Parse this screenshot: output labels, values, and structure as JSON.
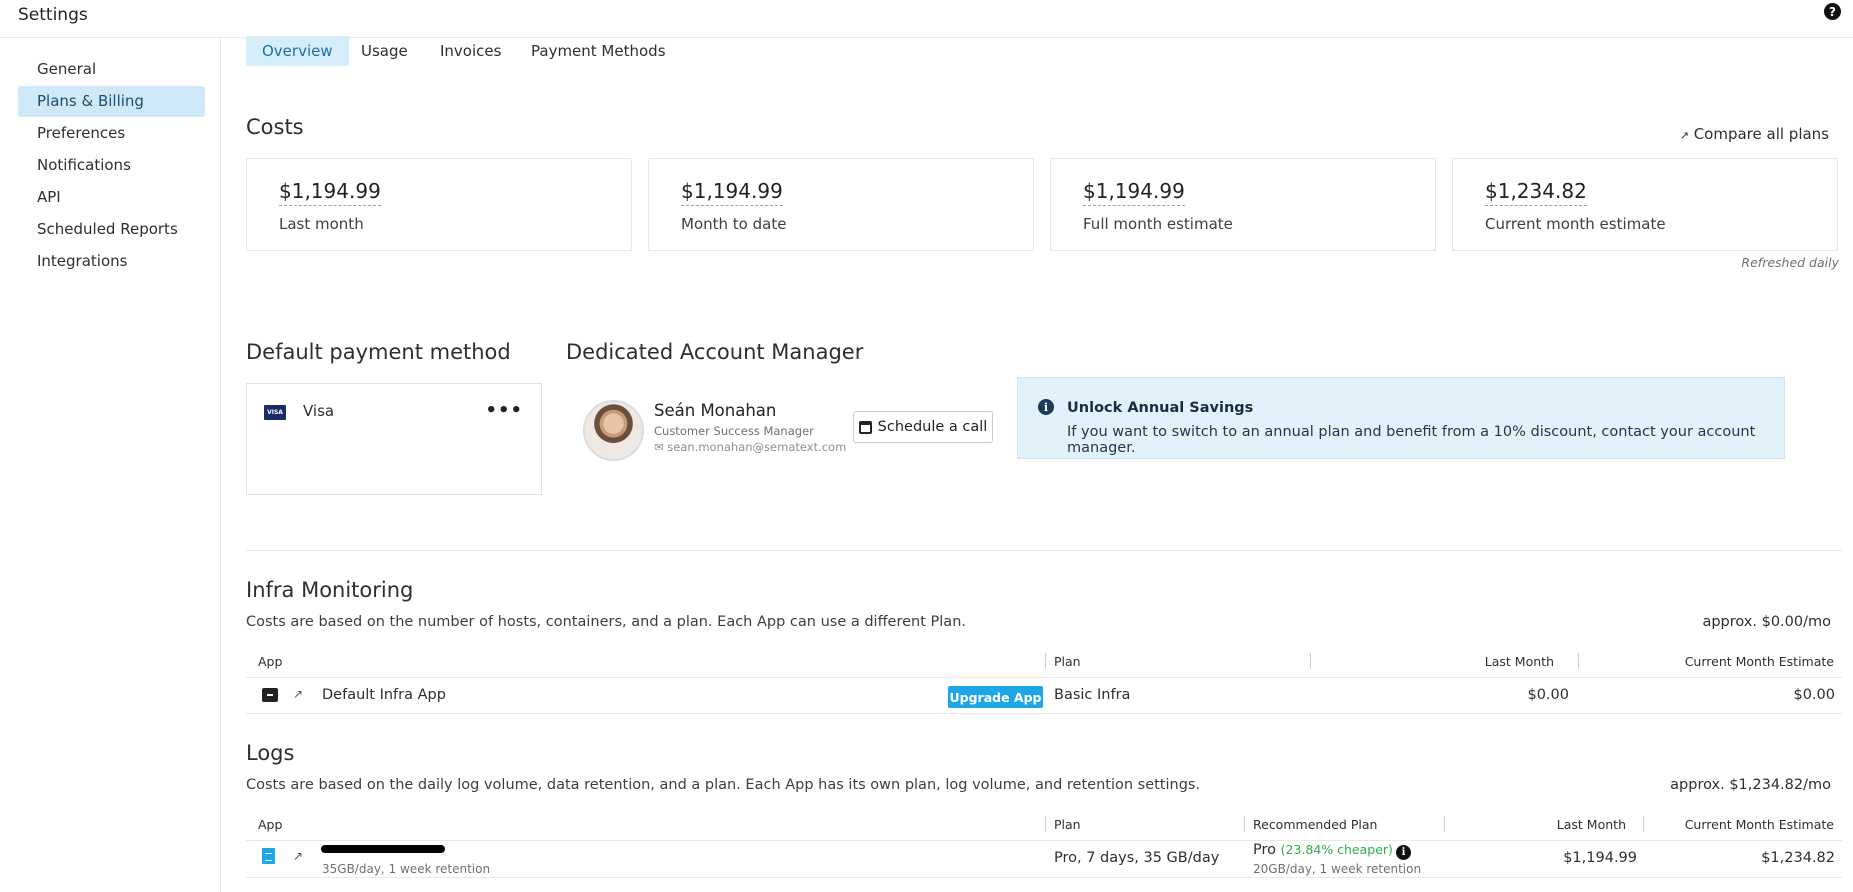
{
  "app": {
    "title": "Settings",
    "help_icon": "?"
  },
  "sidebar": {
    "items": [
      {
        "label": "General"
      },
      {
        "label": "Plans & Billing",
        "active": true
      },
      {
        "label": "Preferences"
      },
      {
        "label": "Notifications"
      },
      {
        "label": "API"
      },
      {
        "label": "Scheduled Reports"
      },
      {
        "label": "Integrations"
      }
    ]
  },
  "tabs": [
    {
      "label": "Overview",
      "active": true
    },
    {
      "label": "Usage"
    },
    {
      "label": "Invoices"
    },
    {
      "label": "Payment Methods"
    }
  ],
  "costs": {
    "title": "Costs",
    "compare_link": "Compare all plans",
    "refreshed": "Refreshed daily",
    "cards": [
      {
        "value": "$1,194.99",
        "label": "Last month"
      },
      {
        "value": "$1,194.99",
        "label": "Month to date"
      },
      {
        "value": "$1,194.99",
        "label": "Full month estimate"
      },
      {
        "value": "$1,234.82",
        "label": "Current month estimate"
      }
    ]
  },
  "payment": {
    "title": "Default payment method",
    "card_brand": "Visa",
    "badge": "VISA",
    "more": "•••"
  },
  "account_manager": {
    "title": "Dedicated Account Manager",
    "name": "Seán Monahan",
    "role": "Customer Success Manager",
    "email": "sean.monahan@sematext.com",
    "schedule_label": "Schedule a call"
  },
  "savings": {
    "title": "Unlock Annual Savings",
    "text": "If you want to switch to an annual plan and benefit from a 10% discount, contact your account manager.",
    "icon": "i"
  },
  "infra": {
    "title": "Infra Monitoring",
    "description": "Costs are based on the number of hosts, containers, and a plan. Each App can use a different Plan.",
    "approx": "approx. $0.00/mo",
    "headers": {
      "app": "App",
      "plan": "Plan",
      "last_month": "Last Month",
      "current": "Current Month Estimate"
    },
    "rows": [
      {
        "app": "Default Infra App",
        "upgrade": "Upgrade App",
        "plan": "Basic Infra",
        "last_month": "$0.00",
        "current": "$0.00"
      }
    ]
  },
  "logs": {
    "title": "Logs",
    "description": "Costs are based on the daily log volume, data retention, and a plan. Each App has its own plan, log volume, and retention settings.",
    "approx": "approx. $1,234.82/mo",
    "headers": {
      "app": "App",
      "plan": "Plan",
      "recommended": "Recommended Plan",
      "last_month": "Last Month",
      "current": "Current Month Estimate"
    },
    "rows": [
      {
        "app_sub": "35GB/day, 1 week retention",
        "plan": "Pro, 7 days, 35 GB/day",
        "recommended": "Pro",
        "recommended_note": "(23.84% cheaper)",
        "recommended_sub": "20GB/day, 1 week retention",
        "last_month": "$1,194.99",
        "current": "$1,234.82"
      }
    ]
  },
  "icons": {
    "external_link": "↗",
    "archive": "archive-icon",
    "document": "document-icon",
    "mail": "✉"
  }
}
